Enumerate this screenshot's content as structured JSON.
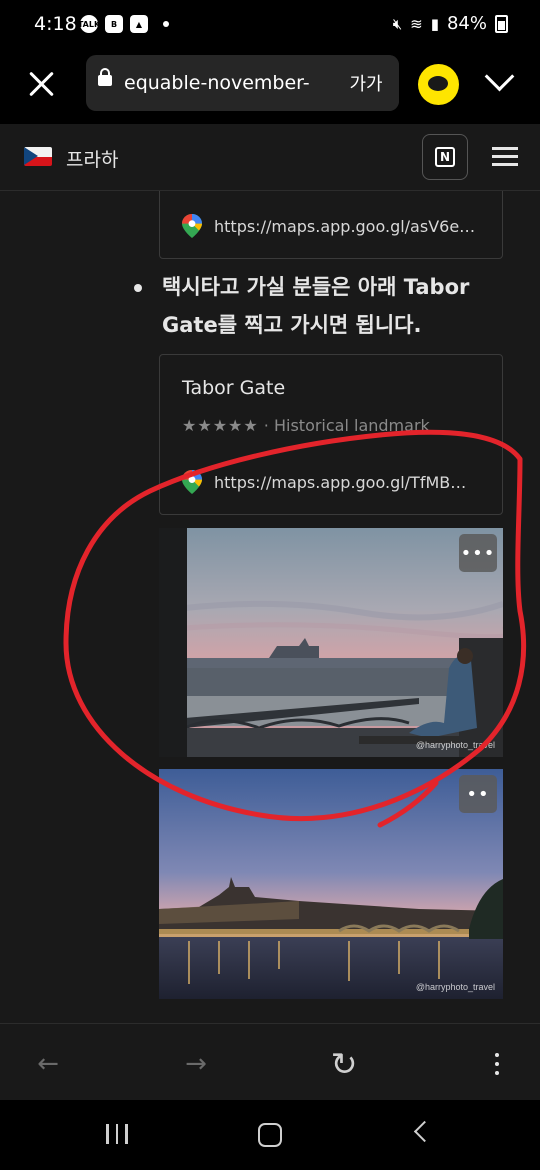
{
  "status_bar": {
    "time": "4:18",
    "battery": "84%",
    "icons": [
      "talk-icon",
      "blog-b-icon",
      "gallery-icon",
      "dot-icon",
      "mute-icon",
      "wifi-icon",
      "signal-icon",
      "battery-icon"
    ],
    "talk_badge": "TALK",
    "blog_badge": "B"
  },
  "browser": {
    "url": "equable-november-",
    "text_size_label": "가가",
    "icons": [
      "close-icon",
      "lock-icon",
      "kakaotalk-icon",
      "chevron-down-icon"
    ]
  },
  "site_header": {
    "title": "프라하",
    "flag": "czech-flag-icon",
    "notion_letter": "N"
  },
  "content": {
    "prev_bookmark_link": "https://maps.app.goo.gl/asV6e…",
    "bullet_text": "택시타고 가실 분들은 아래 Tabor Gate를 찍고 가시면 됩니다.",
    "bookmark": {
      "title": "Tabor Gate",
      "stars": "★★★★★",
      "description": " · Historical landmark",
      "link": "https://maps.app.goo.gl/TfMB…"
    },
    "photos": [
      {
        "watermark": "@harryphoto_travel",
        "more": "•••"
      },
      {
        "watermark": "@harryphoto_travel",
        "more": "••"
      }
    ],
    "annotation_color": "#e3242b"
  },
  "bottom_nav": {
    "back": "←",
    "forward": "→",
    "reload": "↻"
  },
  "colors": {
    "background": "#191919",
    "kakao_yellow": "#fee500"
  }
}
